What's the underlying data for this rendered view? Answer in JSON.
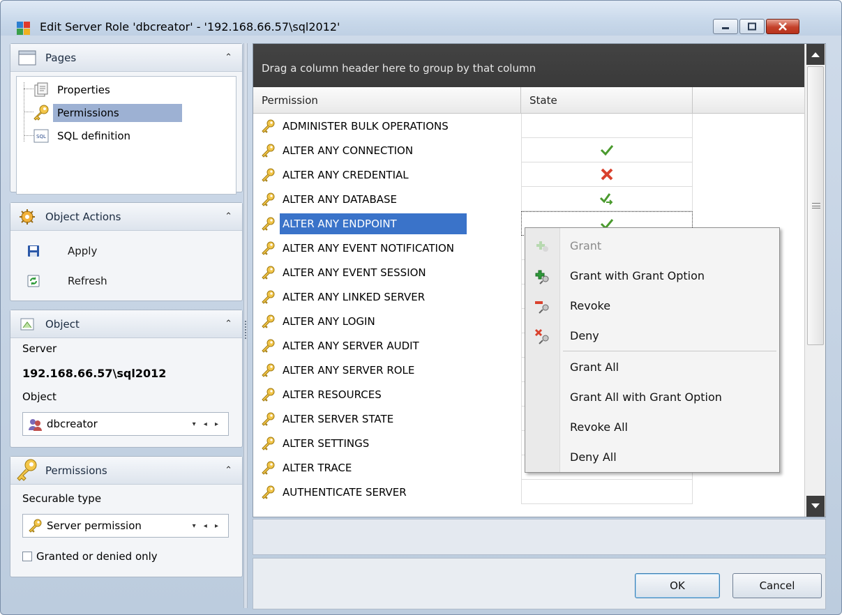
{
  "window": {
    "title": "Edit Server Role 'dbcreator' - '192.168.66.57\\sql2012'"
  },
  "pages_panel": {
    "title": "Pages",
    "items": [
      {
        "label": "Properties",
        "icon": "properties-icon"
      },
      {
        "label": "Permissions",
        "icon": "key-icon",
        "selected": true
      },
      {
        "label": "SQL definition",
        "icon": "sql-icon"
      }
    ]
  },
  "actions_panel": {
    "title": "Object Actions",
    "items": [
      {
        "label": "Apply",
        "icon": "save-icon"
      },
      {
        "label": "Refresh",
        "icon": "refresh-icon"
      }
    ]
  },
  "object_panel": {
    "title": "Object",
    "server_label": "Server",
    "server_value": "192.168.66.57\\sql2012",
    "object_label": "Object",
    "object_value": "dbcreator"
  },
  "permissions_panel": {
    "title": "Permissions",
    "securable_label": "Securable type",
    "securable_value": "Server permission",
    "checkbox_label": "Granted or denied only"
  },
  "grid": {
    "group_hint": "Drag a column header here to group by that column",
    "columns": [
      "Permission",
      "State"
    ],
    "rows": [
      {
        "permission": "ADMINISTER BULK OPERATIONS",
        "state": ""
      },
      {
        "permission": "ALTER ANY CONNECTION",
        "state": "grant"
      },
      {
        "permission": "ALTER ANY CREDENTIAL",
        "state": "deny"
      },
      {
        "permission": "ALTER ANY DATABASE",
        "state": "grant-with-grant"
      },
      {
        "permission": "ALTER ANY ENDPOINT",
        "state": "grant",
        "selected": true
      },
      {
        "permission": "ALTER ANY EVENT NOTIFICATION",
        "state": ""
      },
      {
        "permission": "ALTER ANY EVENT SESSION",
        "state": ""
      },
      {
        "permission": "ALTER ANY LINKED SERVER",
        "state": ""
      },
      {
        "permission": "ALTER ANY LOGIN",
        "state": ""
      },
      {
        "permission": "ALTER ANY SERVER AUDIT",
        "state": ""
      },
      {
        "permission": "ALTER ANY SERVER ROLE",
        "state": ""
      },
      {
        "permission": "ALTER RESOURCES",
        "state": ""
      },
      {
        "permission": "ALTER SERVER STATE",
        "state": ""
      },
      {
        "permission": "ALTER SETTINGS",
        "state": ""
      },
      {
        "permission": "ALTER TRACE",
        "state": ""
      },
      {
        "permission": "AUTHENTICATE SERVER",
        "state": ""
      }
    ]
  },
  "context_menu": {
    "items": [
      {
        "label": "Grant",
        "icon": "grant-icon",
        "disabled": true
      },
      {
        "label": "Grant with Grant Option",
        "icon": "grant-with-grant-icon"
      },
      {
        "label": "Revoke",
        "icon": "revoke-icon"
      },
      {
        "label": "Deny",
        "icon": "deny-icon"
      },
      {
        "label": "Grant All"
      },
      {
        "label": "Grant All with Grant Option"
      },
      {
        "label": "Revoke All"
      },
      {
        "label": "Deny All"
      }
    ]
  },
  "buttons": {
    "ok": "OK",
    "cancel": "Cancel"
  },
  "colors": {
    "selection": "#3a73c9",
    "grant_green": "#4a9a2e",
    "deny_red": "#d9412d"
  }
}
